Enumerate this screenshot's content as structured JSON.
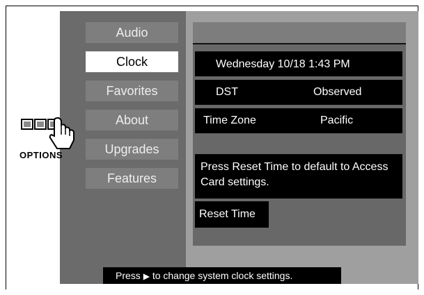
{
  "menu": {
    "items": [
      {
        "label": "Audio"
      },
      {
        "label": "Clock"
      },
      {
        "label": "Favorites"
      },
      {
        "label": "About"
      },
      {
        "label": "Upgrades"
      },
      {
        "label": "Features"
      }
    ],
    "selected_index": 1
  },
  "clock": {
    "datetime": "Wednesday 10/18 1:43 PM",
    "dst_label": "DST",
    "dst_value": "Observed",
    "timezone_label": "Time Zone",
    "timezone_value": "Pacific",
    "info": "Press Reset Time to default to Access Card settings.",
    "reset_button_label": "Reset Time"
  },
  "status": {
    "prefix": "Press",
    "arrow_icon": "right-arrow-icon",
    "suffix": "to change system clock settings."
  },
  "options_icon": {
    "label": "OPTIONS",
    "icon": "options-remote-hand-icon"
  }
}
